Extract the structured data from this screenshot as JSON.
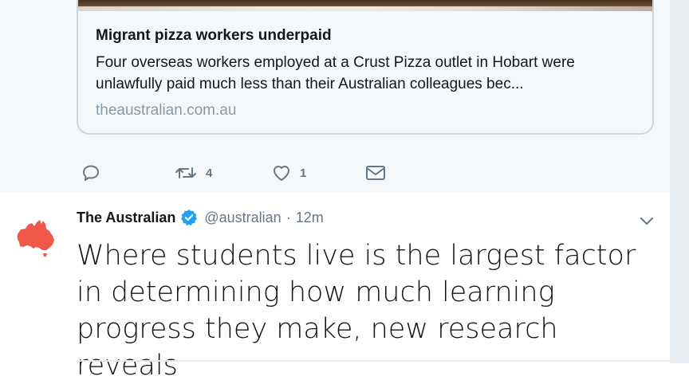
{
  "card": {
    "title": "Migrant pizza workers underpaid",
    "description": "Four overseas workers employed at a Crust Pizza outlet in Hobart were unlawfully paid much less than their Australian colleagues bec...",
    "domain": "theaustralian.com.au"
  },
  "actions": {
    "reply_icon": "reply-icon",
    "retweet_icon": "retweet-icon",
    "retweet_count": "4",
    "like_icon": "heart-icon",
    "like_count": "1",
    "dm_icon": "envelope-icon"
  },
  "tweet": {
    "fullname": "The Australian",
    "verified_icon": "verified-badge-icon",
    "screen_name": "@australian",
    "separator": "·",
    "timestamp": "12m",
    "text": "Where students live is the largest factor in determining how much learning progress they make, new research reveals",
    "avatar_icon": "australia-map-logo",
    "menu_icon": "chevron-down-icon"
  },
  "colors": {
    "accent": "#1da1f2",
    "brand_red": "#f0594a",
    "muted": "#657786",
    "background_tint": "#f5f8fa"
  }
}
